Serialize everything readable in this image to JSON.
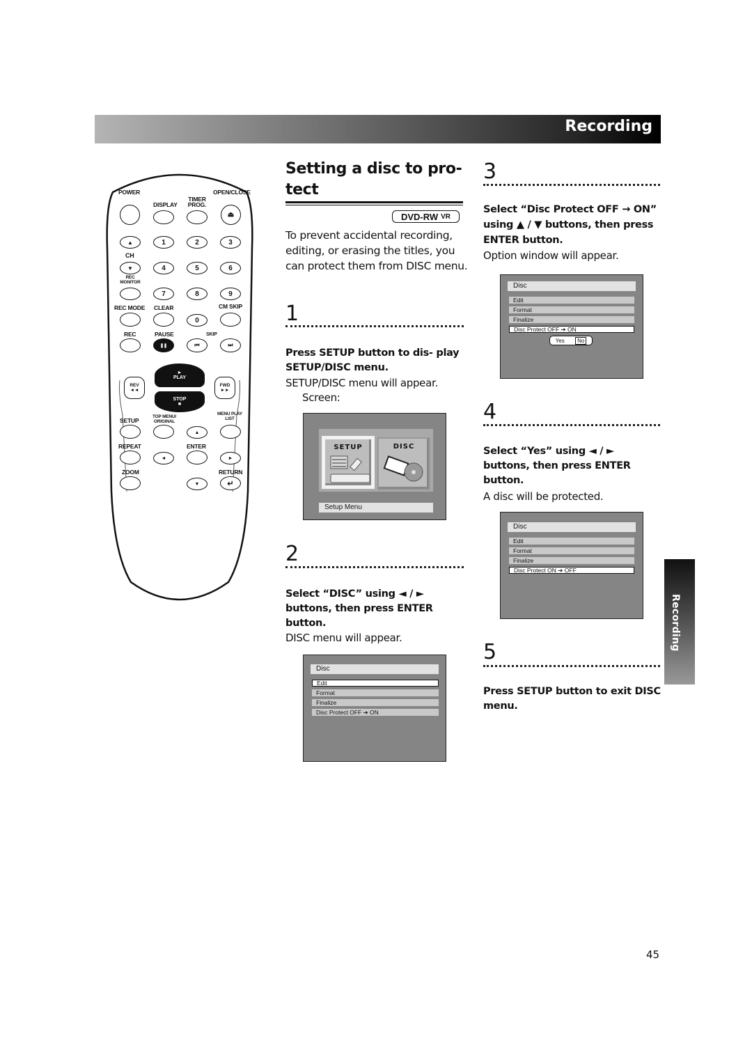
{
  "header": {
    "section_title": "Recording"
  },
  "side_tab": {
    "label": "Recording"
  },
  "page_number": "45",
  "remote": {
    "labels": {
      "power": "POWER",
      "display": "DISPLAY",
      "timer_prog": "TIMER PROG.",
      "open_close": "OPEN/CLOSE",
      "ch": "CH",
      "rec_monitor": "REC MONITOR",
      "rec_mode": "REC MODE",
      "clear": "CLEAR",
      "cm_skip": "CM SKIP",
      "rec": "REC",
      "pause": "PAUSE",
      "skip": "SKIP",
      "play": "PLAY",
      "rev": "REV",
      "fwd": "FWD",
      "stop": "STOP",
      "setup": "SETUP",
      "top_menu": "TOP MENU/ ORIGINAL",
      "menu": "MENU PLAY LIST",
      "repeat": "REPEAT",
      "enter": "ENTER",
      "zoom": "ZOOM",
      "return": "RETURN"
    },
    "digits": [
      "1",
      "2",
      "3",
      "4",
      "5",
      "6",
      "7",
      "8",
      "9",
      "0"
    ],
    "icons": {
      "eject": "⏏",
      "up": "▲",
      "down": "▼",
      "left": "◄",
      "right": "►",
      "pause": "❚❚",
      "prev": "⏮",
      "next": "⏭",
      "rev": "◄◄",
      "fwd": "►►",
      "play": "►",
      "stop": "■",
      "return": "↵"
    }
  },
  "section": {
    "title": "Setting a disc to pro- tect",
    "badge_main": "DVD-RW",
    "badge_sub": "VR",
    "intro": "To prevent accidental recording, editing, or erasing the titles, you can protect them from DISC menu."
  },
  "steps": [
    {
      "number": "1",
      "instruction": "Press SETUP button to dis- play SETUP/DISC menu.",
      "description": "SETUP/DISC menu will appear.",
      "note": "Screen:"
    },
    {
      "number": "2",
      "instruction": "Select “DISC” using ◄ / ► buttons, then press ENTER button.",
      "description": "DISC menu will appear."
    },
    {
      "number": "3",
      "instruction": "Select “Disc Protect OFF → ON” using ▲ / ▼ buttons, then press ENTER button.",
      "description": "Option window will appear."
    },
    {
      "number": "4",
      "instruction": "Select “Yes” using ◄ / ► buttons, then press ENTER button.",
      "description": "A disc will be protected."
    },
    {
      "number": "5",
      "instruction": "Press SETUP button to exit DISC menu."
    }
  ],
  "screens": {
    "setup_menu": {
      "tiles": [
        "SETUP",
        "DISC"
      ],
      "selected": "SETUP",
      "footer": "Setup Menu"
    },
    "disc_menu_1": {
      "title": "Disc",
      "items": [
        "Edit",
        "Format",
        "Finalize",
        "Disc Protect OFF ➔ ON"
      ],
      "selected": "Edit"
    },
    "disc_menu_3": {
      "title": "Disc",
      "items": [
        "Edit",
        "Format",
        "Finalize",
        "Disc Protect OFF ➔ ON"
      ],
      "selected": "Disc Protect OFF ➔ ON",
      "options": [
        "Yes",
        "No"
      ],
      "option_selected": "No"
    },
    "disc_menu_4": {
      "title": "Disc",
      "items": [
        "Edit",
        "Format",
        "Finalize",
        "Disc Protect ON ➔ OFF"
      ],
      "selected": "Disc Protect ON ➔ OFF"
    }
  }
}
